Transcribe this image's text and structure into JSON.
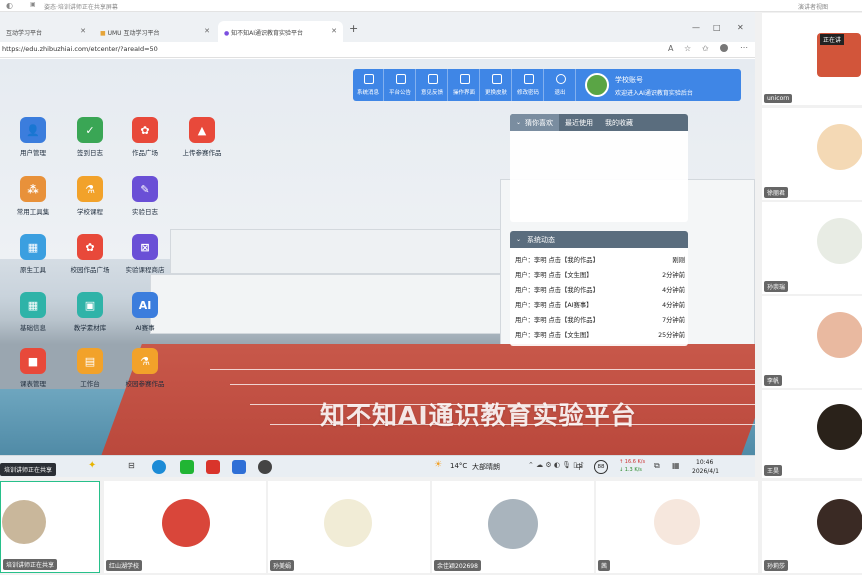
{
  "meeting": {
    "top_title": "姿态·培训讲师正在共享屏幕",
    "top_right_label": "演讲者视图",
    "sharing_badge": "培训讲师正在共享",
    "sharing_badge_top_right": "正在讲"
  },
  "browser": {
    "tabs": [
      {
        "label": "互动学习平台"
      },
      {
        "label": "UMU 互动学习平台"
      },
      {
        "label": "知不知AI通识教育实验平台"
      }
    ],
    "new_tab": "+",
    "url": "https://edu.zhibuzhiai.com/etcenter/?areaId=50",
    "window_controls": [
      "—",
      "□",
      "✕"
    ]
  },
  "site": {
    "watermark": "知不知AI通识教育实验平台",
    "apps": [
      {
        "label": "用户管理",
        "color": "#3b7ddd"
      },
      {
        "label": "签到日志",
        "color": "#3aa655"
      },
      {
        "label": "作品广场",
        "color": "#e8493a"
      },
      {
        "label": "上传参赛作品",
        "color": "#e8493a"
      },
      {
        "label": "常用工具集",
        "color": "#e8913a"
      },
      {
        "label": "学校课程",
        "color": "#f2a22a"
      },
      {
        "label": "实验日志",
        "color": "#6a4fd6"
      },
      {
        "label": "原生工具",
        "color": "#3b9fe0"
      },
      {
        "label": "校园作品广场",
        "color": "#e8493a"
      },
      {
        "label": "实验课程商店",
        "color": "#6a4fd6"
      },
      {
        "label": "基础信息",
        "color": "#2fb3a8"
      },
      {
        "label": "教学素材库",
        "color": "#2fb3a8"
      },
      {
        "label": "AI赛事",
        "color": "#3b7ddd"
      },
      {
        "label": "课表管理",
        "color": "#e8493a"
      },
      {
        "label": "工作台",
        "color": "#f2a22a"
      },
      {
        "label": "校园参赛作品",
        "color": "#f2a22a"
      }
    ],
    "toolbar": [
      {
        "label": "系统消息"
      },
      {
        "label": "平台公告"
      },
      {
        "label": "意见反馈"
      },
      {
        "label": "操作界面"
      },
      {
        "label": "更换皮肤"
      },
      {
        "label": "修改密码"
      },
      {
        "label": "退出"
      }
    ],
    "account": {
      "title": "学校账号",
      "welcome": "欢迎进入AI通识教育实验后台"
    },
    "favorites": {
      "tabs": [
        "猜你喜欢",
        "最近使用",
        "我的收藏"
      ]
    },
    "dynamics": {
      "title": "系统动态",
      "rows": [
        {
          "text": "用户：李明 点击【我的作品】",
          "time": "刚刚"
        },
        {
          "text": "用户：李明 点击【文生图】",
          "time": "2分钟前"
        },
        {
          "text": "用户：李明 点击【我的作品】",
          "time": "4分钟前"
        },
        {
          "text": "用户：李明 点击【AI赛事】",
          "time": "4分钟前"
        },
        {
          "text": "用户：李明 点击【我的作品】",
          "time": "7分钟前"
        },
        {
          "text": "用户：李明 点击【文生图】",
          "time": "25分钟前"
        }
      ]
    }
  },
  "taskbar": {
    "weather_temp": "14°C",
    "weather_text": "大部晴朗",
    "lang": "中",
    "battery": "88",
    "net_up": "↑ 16.6 K/s",
    "net_down": "↓ 1.3 K/s",
    "time": "10:46",
    "date": "2026/4/1"
  },
  "participants_right": [
    {
      "name": "unicorn"
    },
    {
      "name": "徐丽君"
    },
    {
      "name": "孙崇瑞"
    },
    {
      "name": "李帆"
    },
    {
      "name": "王昊"
    },
    {
      "name": "孙莉莎"
    }
  ],
  "participants_bottom": [
    {
      "name": "培训讲师正在共享"
    },
    {
      "name": "红山湖学校"
    },
    {
      "name": "孙美娟"
    },
    {
      "name": "余佳颖202698"
    },
    {
      "name": "茜"
    }
  ]
}
